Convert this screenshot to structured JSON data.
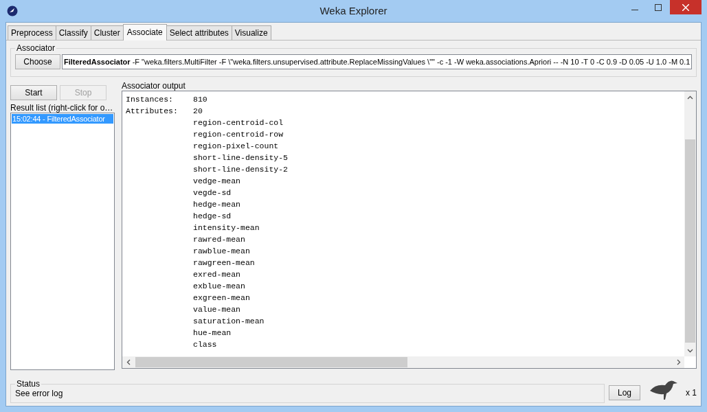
{
  "window": {
    "title": "Weka Explorer"
  },
  "tabs": [
    {
      "label": "Preprocess",
      "selected": false
    },
    {
      "label": "Classify",
      "selected": false
    },
    {
      "label": "Cluster",
      "selected": false
    },
    {
      "label": "Associate",
      "selected": true
    },
    {
      "label": "Select attributes",
      "selected": false
    },
    {
      "label": "Visualize",
      "selected": false
    }
  ],
  "associator": {
    "title": "Associator",
    "choose_button": "Choose",
    "command": "**FilteredAssociator** -F \"weka.filters.MultiFilter -F \\\"weka.filters.unsupervised.attribute.ReplaceMissingValues \\\"\" -c -1 -W weka.associations.Apriori -- -N 10 -T 0 -C 0.9 -D 0.05 -U 1.0 -M 0.1"
  },
  "buttons": [
    {
      "label": "Start",
      "disabled": false
    },
    {
      "label": "Stop",
      "disabled": true
    }
  ],
  "result_list": {
    "title": "Result list (right-click for o…",
    "items": [
      {
        "label": "15:02:44 - FilteredAssociator",
        "selected": true
      }
    ]
  },
  "output": {
    "title": "Associator output",
    "lines": [
      {
        "label": "Instances:",
        "value": "810"
      },
      {
        "label": "Attributes:",
        "value": "20"
      },
      {
        "value": "region-centroid-col"
      },
      {
        "value": "region-centroid-row"
      },
      {
        "value": "region-pixel-count"
      },
      {
        "value": "short-line-density-5"
      },
      {
        "value": "short-line-density-2"
      },
      {
        "value": "vedge-mean"
      },
      {
        "value": "vegde-sd"
      },
      {
        "value": "hedge-mean"
      },
      {
        "value": "hedge-sd"
      },
      {
        "value": "intensity-mean"
      },
      {
        "value": "rawred-mean"
      },
      {
        "value": "rawblue-mean"
      },
      {
        "value": "rawgreen-mean"
      },
      {
        "value": "exred-mean"
      },
      {
        "value": "exblue-mean"
      },
      {
        "value": "exgreen-mean"
      },
      {
        "value": "value-mean"
      },
      {
        "value": "saturation-mean"
      },
      {
        "value": "hue-mean"
      },
      {
        "value": "class"
      }
    ]
  },
  "status": {
    "title": "Status",
    "text": "See error log",
    "log_button": "Log",
    "count": "x 1"
  }
}
